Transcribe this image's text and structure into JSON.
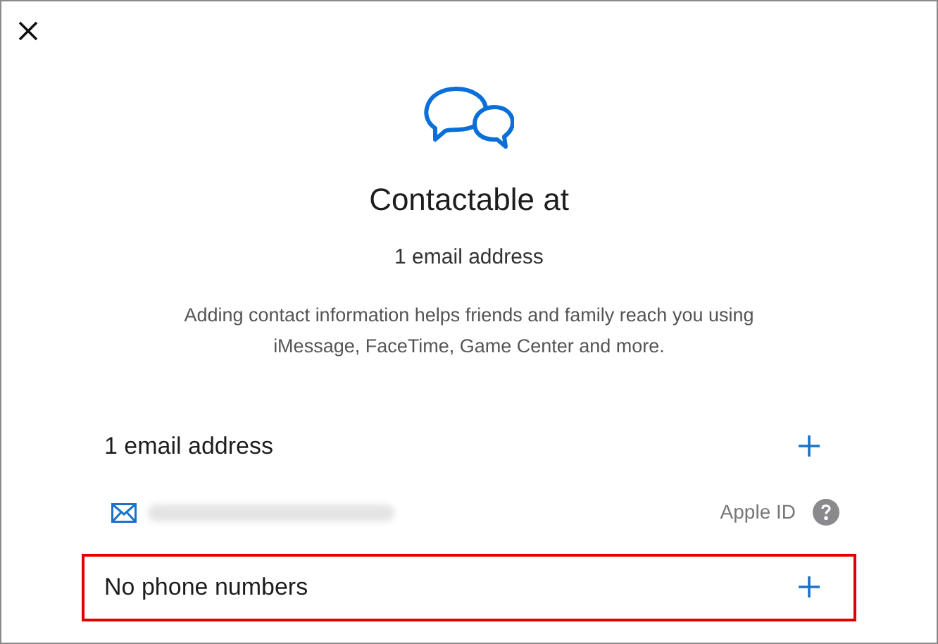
{
  "title": "Contactable at",
  "subtitle": "1 email address",
  "description": "Adding contact information helps friends and family reach you using iMessage, FaceTime, Game Center and more.",
  "sections": [
    {
      "heading": "1 email address",
      "highlighted": false,
      "items": [
        {
          "kind": "email",
          "redacted": true,
          "badge": "Apple ID"
        }
      ]
    },
    {
      "heading": "No phone numbers",
      "highlighted": true
    }
  ]
}
